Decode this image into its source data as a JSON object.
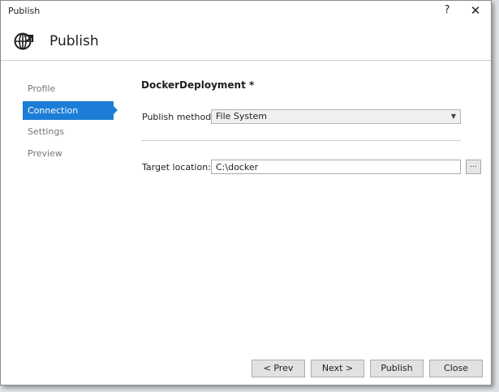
{
  "window": {
    "title": "Publish",
    "help": "?",
    "close": "✕"
  },
  "header": {
    "title": "Publish",
    "icon": "globe-publish-icon"
  },
  "sidebar": {
    "items": [
      {
        "label": "Profile"
      },
      {
        "label": "Connection",
        "active": true
      },
      {
        "label": "Settings"
      },
      {
        "label": "Preview"
      }
    ]
  },
  "main": {
    "profile_name": "DockerDeployment *",
    "publish_method_label": "Publish method:",
    "publish_method_value": "File System",
    "target_location_label": "Target location:",
    "target_location_value": "C:\\docker",
    "browse_label": "..."
  },
  "footer": {
    "prev": "< Prev",
    "next": "Next >",
    "publish": "Publish",
    "close": "Close"
  },
  "colors": {
    "accent": "#1c7dd6"
  }
}
